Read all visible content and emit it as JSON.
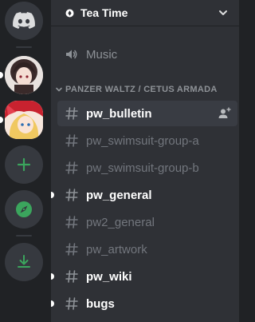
{
  "server": {
    "name": "Tea Time"
  },
  "rail": {
    "items": [
      {
        "name": "home",
        "icon": "discord-logo-icon"
      },
      {
        "name": "server-avatar-1"
      },
      {
        "name": "server-avatar-2"
      },
      {
        "name": "add-server",
        "icon": "plus-icon"
      },
      {
        "name": "explore-servers",
        "icon": "compass-icon"
      },
      {
        "name": "download-apps",
        "icon": "download-icon"
      }
    ],
    "accent": "#3ba55d"
  },
  "voice_channel": {
    "label": "Music",
    "icon": "speaker-icon"
  },
  "category": {
    "label": "PANZER WALTZ / CETUS ARMADA"
  },
  "channels": [
    {
      "label": "pw_bulletin",
      "state": "selected"
    },
    {
      "label": "pw_swimsuit-group-a",
      "state": "read"
    },
    {
      "label": "pw_swimsuit-group-b",
      "state": "read"
    },
    {
      "label": "pw_general",
      "state": "unread"
    },
    {
      "label": "pw2_general",
      "state": "read"
    },
    {
      "label": "pw_artwork",
      "state": "read"
    },
    {
      "label": "pw_wiki",
      "state": "unread"
    },
    {
      "label": "bugs",
      "state": "unread"
    }
  ],
  "colors": {
    "rail_bg": "#202225",
    "panel_bg": "#2f3136",
    "selected_bg": "#393c43",
    "muted_text": "#72767d",
    "category_text": "#8e9297",
    "brand": "#5865f2"
  }
}
